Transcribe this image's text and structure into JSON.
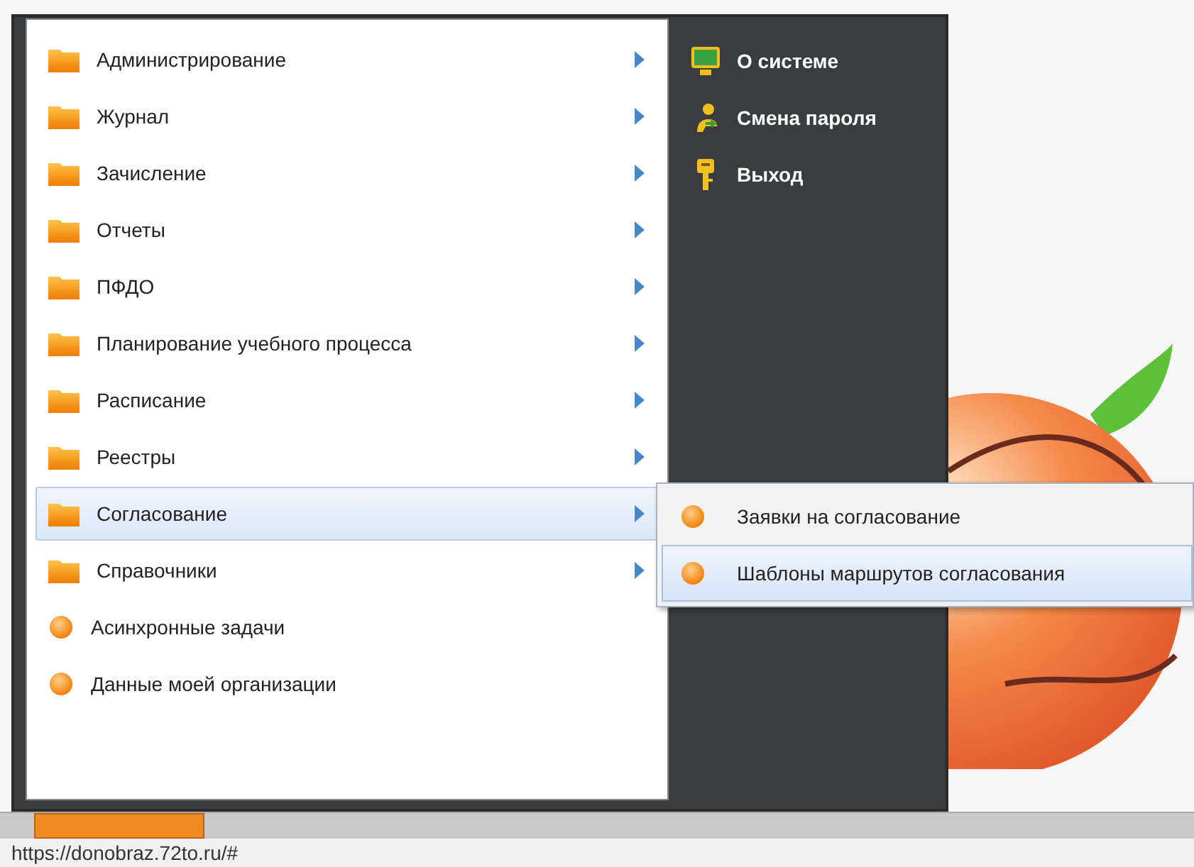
{
  "menu": {
    "items": [
      {
        "kind": "folder",
        "label": "Администрирование",
        "selected": false
      },
      {
        "kind": "folder",
        "label": "Журнал",
        "selected": false
      },
      {
        "kind": "folder",
        "label": "Зачисление",
        "selected": false
      },
      {
        "kind": "folder",
        "label": "Отчеты",
        "selected": false
      },
      {
        "kind": "folder",
        "label": "ПФДО",
        "selected": false
      },
      {
        "kind": "folder",
        "label": "Планирование учебного процесса",
        "selected": false
      },
      {
        "kind": "folder",
        "label": "Расписание",
        "selected": false
      },
      {
        "kind": "folder",
        "label": "Реестры",
        "selected": false
      },
      {
        "kind": "folder",
        "label": "Согласование",
        "selected": true
      },
      {
        "kind": "folder",
        "label": "Справочники",
        "selected": false
      },
      {
        "kind": "leaf",
        "label": "Асинхронные задачи",
        "selected": false
      },
      {
        "kind": "leaf",
        "label": "Данные моей организации",
        "selected": false
      }
    ]
  },
  "system_panel": {
    "items": [
      {
        "kind": "about",
        "label": "О системе"
      },
      {
        "kind": "password",
        "label": "Смена пароля"
      },
      {
        "kind": "exit",
        "label": "Выход"
      }
    ]
  },
  "submenu": {
    "items": [
      {
        "label": "Заявки на согласование",
        "selected": false
      },
      {
        "label": "Шаблоны маршрутов согласования",
        "selected": true
      }
    ]
  },
  "status_bar": {
    "url": "https://donobraz.72to.ru/#"
  }
}
